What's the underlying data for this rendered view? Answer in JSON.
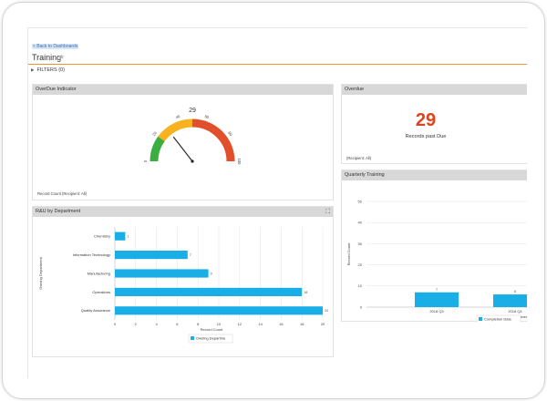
{
  "header": {
    "back_link": "< Back to Dashboards",
    "title": "Training",
    "filters_label": "FILTERS (0)"
  },
  "icons": {
    "star": "star-icon",
    "expand": "expand-icon",
    "filters_caret": "caret-right-icon"
  },
  "colors": {
    "accent_orange": "#f0942c",
    "bar_blue": "#1aaee6",
    "overdue_red": "#e0431b",
    "gauge_green": "#3aae3f",
    "gauge_yellow": "#f7b21e",
    "gauge_red": "#e14f2b"
  },
  "panels": {
    "overdue_indicator": {
      "title": "OverDue Indicator",
      "footer": "Record Count (Recipient: All)",
      "gauge": {
        "value": 29,
        "value_label": "29",
        "min": 0,
        "max": 100,
        "ticks": [
          "0",
          "20",
          "40",
          "60",
          "80",
          "100"
        ]
      }
    },
    "overdue": {
      "title": "Overdue",
      "value": "29",
      "label": "Records past Due",
      "footer": "(Recipient: All)"
    },
    "rd_by_department": {
      "title": "R&U by Department",
      "y_axis_title": "Owning Department",
      "legend": "Owning Departme"
    },
    "quarterly_training": {
      "title": "Quarterly Training",
      "y_axis_title": "Record Count",
      "legend": "Completion Date"
    }
  },
  "chart_data": [
    {
      "type": "bar",
      "orientation": "horizontal",
      "title": "R&U by Department",
      "categories": [
        "Chemistry",
        "Information Technology",
        "Manufacturing",
        "Operations",
        "Quality Assurance"
      ],
      "values": [
        1,
        7,
        9,
        18,
        20
      ],
      "value_labels": [
        "1",
        "7",
        "9",
        "18",
        "20"
      ],
      "xlabel": "Record Count",
      "ylabel": "Owning Department",
      "xlim": [
        0,
        20
      ],
      "xticks": [
        "0",
        "2",
        "4",
        "6",
        "8",
        "10",
        "12",
        "14",
        "16",
        "18",
        "20"
      ],
      "grid": true,
      "legend": "bottom"
    },
    {
      "type": "bar",
      "orientation": "vertical",
      "title": "Quarterly Training",
      "categories": [
        "2018 Q3",
        "2018 Q4"
      ],
      "values": [
        7,
        6
      ],
      "value_labels": [
        "7",
        "6"
      ],
      "xlabel": "Completion Date (Quarter)",
      "ylabel": "Record Count",
      "ylim": [
        0,
        50
      ],
      "yticks": [
        "0",
        "10",
        "20",
        "30",
        "40",
        "50"
      ],
      "grid": true,
      "legend": "bottom"
    }
  ]
}
